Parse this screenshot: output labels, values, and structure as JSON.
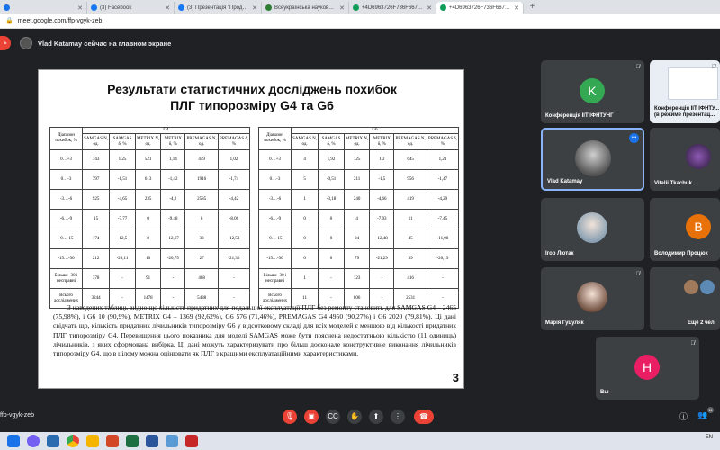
{
  "tabs": [
    {
      "title": "",
      "color": "#1a73e8",
      "active": false
    },
    {
      "title": "(3) Facebook",
      "color": "#1877f2",
      "active": false
    },
    {
      "title": "(3) Презентація \"Продукція ROA...",
      "color": "#1877f2",
      "active": false
    },
    {
      "title": "Всеукраїнська науково-практи...",
      "color": "#2e7d32",
      "active": false
    },
    {
      "title": "+4D6963726F736F667420506F...",
      "color": "#0f9d58",
      "active": false
    },
    {
      "title": "+4D6963726F736F667420506F...",
      "color": "#0f9d58",
      "active": true
    }
  ],
  "address": {
    "url": "meet.google.com/ffp-vgyk-zeb"
  },
  "banner": {
    "text": "Vlad Katamay сейчас на главном экране"
  },
  "slide": {
    "title_line1": "Результати статистичних досліджень похибок",
    "title_line2": "ПЛГ типорозміру G4 та G6",
    "table_g4": {
      "group": "G4",
      "range_header": "Діапазон похибок, %",
      "headers": [
        "SAMGAS N, од.",
        "SAMGAS δ, %",
        "METRIX N, од.",
        "METRIX δ, %",
        "PREMAGAS N, од.",
        "PREMAGAS δ, %"
      ],
      "rows": [
        [
          "0…+3",
          "743",
          "1,25",
          "521",
          "1,14",
          "449",
          "1,02"
        ],
        [
          "0…-3",
          "797",
          "-1,51",
          "613",
          "-1,42",
          "1916",
          "-1,74"
        ],
        [
          "-3…-6",
          "925",
          "-4,65",
          "235",
          "-4,2",
          "2585",
          "-4,42"
        ],
        [
          "-6…-9",
          "15",
          "-7,77",
          "0",
          "-9,48",
          "8",
          "-8,06"
        ],
        [
          "-9…-15",
          "174",
          "-12,5",
          "8",
          "-12,67",
          "33",
          "-12,53"
        ],
        [
          "-15…-30",
          "212",
          "-20,11",
          "10",
          "-20,75",
          "27",
          "-21,36"
        ],
        [
          "Більше -30 і несправні",
          "378",
          "-",
          "91",
          "-",
          "468",
          "-"
        ],
        [
          "Всього досліджених",
          "3244",
          "-",
          "1478",
          "-",
          "5488",
          "-"
        ]
      ]
    },
    "table_g6": {
      "group": "G6",
      "range_header": "Діапазон похибок, %",
      "headers": [
        "SAMGAS N, од.",
        "SAMGAS δ, %",
        "METRIX N, од.",
        "METRIX δ, %",
        "PREMAGAS N, од.",
        "PREMAGAS δ, %"
      ],
      "rows": [
        [
          "0…+3",
          "4",
          "1,92",
          "125",
          "1,2",
          "645",
          "1,21"
        ],
        [
          "0…-3",
          "5",
          "-0,51",
          "211",
          "-1,5",
          "956",
          "-1,47"
        ],
        [
          "-3…-6",
          "1",
          "-3,18",
          "240",
          "-4,66",
          "419",
          "-4,29"
        ],
        [
          "-6…-9",
          "0",
          "0",
          "4",
          "-7,93",
          "11",
          "-7,45"
        ],
        [
          "-9…-15",
          "0",
          "0",
          "24",
          "-12,48",
          "45",
          "-11,98"
        ],
        [
          "-15…-30",
          "0",
          "0",
          "79",
          "-21,29",
          "39",
          "-20,19"
        ],
        [
          "Більше -30 і несправні",
          "1",
          "-",
          "123",
          "-",
          "416",
          "-"
        ],
        [
          "Всього досліджених",
          "11",
          "-",
          "806",
          "-",
          "2531",
          "-"
        ]
      ]
    },
    "body": "З наведених таблиць видно що кількість придатних для подальшої експлуатації ПЛГ без ремонту становить для SAMGAS G4 – 2465 (75,98%), і G6 10 (90,9%), METRIX G4 – 1369 (92,62%), G6 576 (71,46%), PREMAGAS G4 4950 (90,27%) і G6 2020 (79,81%). Ці дані свідчать що, кількість придатних лічильників типорозміру G6 у відсотковому складі для всіх моделей є меншою від кількості придатних ПЛГ типорозміру G4. Перевищення цього показника для моделі SAMGAS може бути пояснена недостатньою кількістю (11 одиниць) лічильників, з яких сформована вибірка. Ці дані можуть характеризувати про більш досконале конструктивне виконання лічильників типорозміру G4, що в цілому можна оцінювати як ПЛГ з кращими експлуатаційними характеристиками.",
    "page_number": "3"
  },
  "participants": [
    {
      "name": "Конференція ІІТ ІФНТУНГ",
      "initial": "K",
      "avatar_color": "#34a853",
      "kind": "letter"
    },
    {
      "name": "Конференція ІІТ ІФНТУ... (в режиме презентац...",
      "initial": "",
      "avatar_color": "",
      "kind": "screen"
    },
    {
      "name": "Vlad Katamay",
      "initial": "",
      "avatar_color": "#6b6b6b",
      "kind": "photo"
    },
    {
      "name": "Vitalii Tkachuk",
      "initial": "",
      "avatar_color": "#5a3a6e",
      "kind": "photo"
    },
    {
      "name": "Ігор Лютак",
      "initial": "",
      "avatar_color": "#8a9aa8",
      "kind": "photo"
    },
    {
      "name": "Володимир Процюк",
      "initial": "B",
      "avatar_color": "#e8710a",
      "kind": "letter"
    },
    {
      "name": "Марія Гуцуляк",
      "initial": "",
      "avatar_color": "#b89a8a",
      "kind": "photo"
    },
    {
      "name": "Ещё 2 чел.",
      "initial": "",
      "avatar_color": "#7a5c4a",
      "kind": "more"
    },
    {
      "name": "Вы",
      "initial": "H",
      "avatar_color": "#e91e63",
      "kind": "letter"
    }
  ],
  "bottombar": {
    "meeting_code": "ffp-vgyk-zeb",
    "participants_count": "11"
  },
  "tray": {
    "lang": "EN",
    "time": "",
    "date": ""
  }
}
